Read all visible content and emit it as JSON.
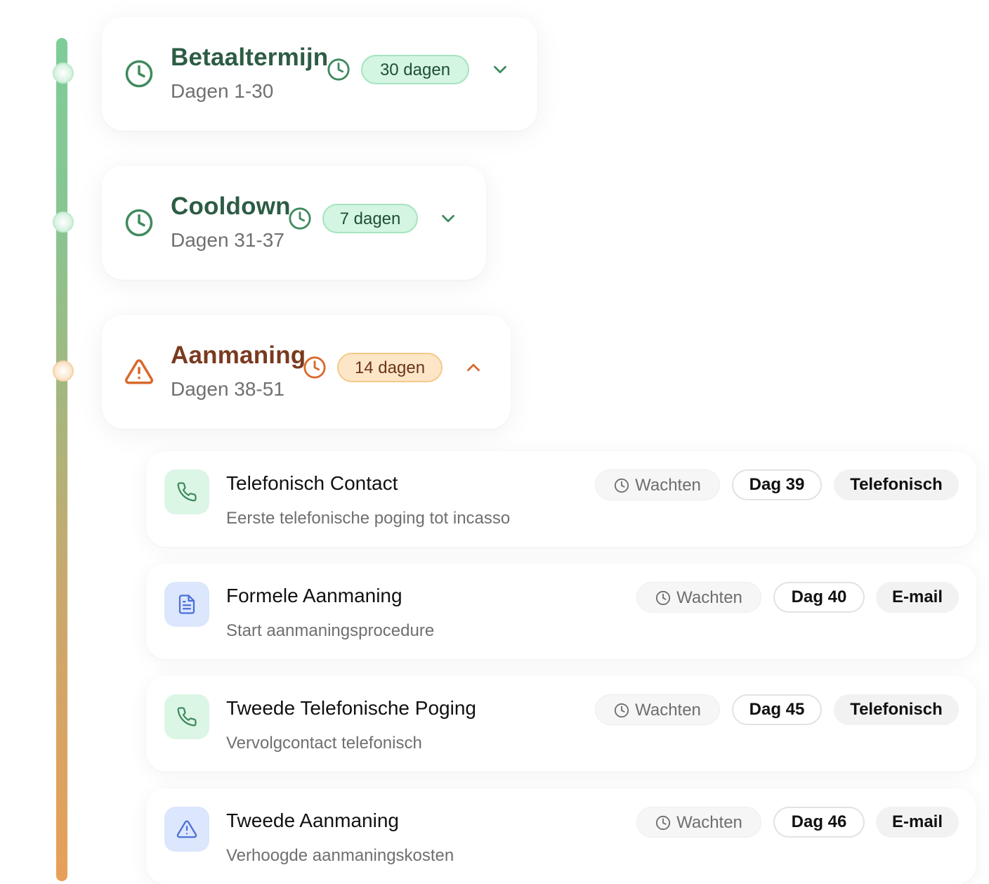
{
  "colors": {
    "green_dark": "#2d5c44",
    "green_icon": "#3f8a5e",
    "orange_dark": "#7a3a1f",
    "orange_icon": "#d9692c",
    "blue_icon": "#4a6fd8"
  },
  "phases": [
    {
      "title": "Betaaltermijn",
      "range": "Dagen 1-30",
      "duration": "30 dagen",
      "icon": "clock-icon",
      "expanded": false
    },
    {
      "title": "Cooldown",
      "range": "Dagen 31-37",
      "duration": "7 dagen",
      "icon": "clock-icon",
      "expanded": false
    },
    {
      "title": "Aanmaning",
      "range": "Dagen 38-51",
      "duration": "14 dagen",
      "icon": "warning-icon",
      "expanded": true
    }
  ],
  "steps": [
    {
      "title": "Telefonisch Contact",
      "description": "Eerste telefonische poging tot incasso",
      "status": "Wachten",
      "day": "Dag 39",
      "channel": "Telefonisch",
      "icon": "phone-icon"
    },
    {
      "title": "Formele Aanmaning",
      "description": "Start aanmaningsprocedure",
      "status": "Wachten",
      "day": "Dag 40",
      "channel": "E-mail",
      "icon": "document-icon"
    },
    {
      "title": "Tweede Telefonische Poging",
      "description": "Vervolgcontact telefonisch",
      "status": "Wachten",
      "day": "Dag 45",
      "channel": "Telefonisch",
      "icon": "phone-icon"
    },
    {
      "title": "Tweede Aanmaning",
      "description": "Verhoogde aanmaningskosten",
      "status": "Wachten",
      "day": "Dag 46",
      "channel": "E-mail",
      "icon": "warning-icon"
    }
  ]
}
